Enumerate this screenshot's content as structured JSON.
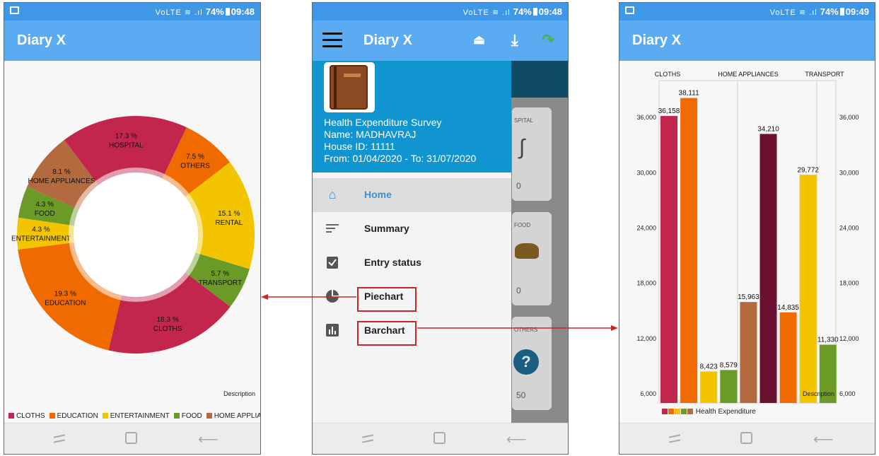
{
  "screen1": {
    "status": {
      "signal": "VoLTE ≋ .ıl",
      "battery": "74%",
      "time": "09:48"
    },
    "app_title": "Diary X",
    "colors": {
      "appbar": "#5aabf1",
      "status": "#3f97e8"
    },
    "pie": {
      "slices": [
        {
          "name": "HOSPITAL",
          "percent": "17.3 %",
          "value": 17.3,
          "color": "#c2264d"
        },
        {
          "name": "OTHERS",
          "percent": "7.5 %",
          "value": 7.5,
          "color": "#f06a00"
        },
        {
          "name": "RENTAL",
          "percent": "15.1 %",
          "value": 15.1,
          "color": "#f2c500"
        },
        {
          "name": "TRANSPORT",
          "percent": "5.7 %",
          "value": 5.7,
          "color": "#6b9a26"
        },
        {
          "name": "CLOTHS",
          "percent": "18.3 %",
          "value": 18.3,
          "color": "#c2264d"
        },
        {
          "name": "EDUCATION",
          "percent": "19.3 %",
          "value": 19.3,
          "color": "#f06a00"
        },
        {
          "name": "ENTERTAINMENT",
          "percent": "4.3 %",
          "value": 4.3,
          "color": "#f2c500"
        },
        {
          "name": "FOOD",
          "percent": "4.3 %",
          "value": 4.3,
          "color": "#6b9a26"
        },
        {
          "name": "HOME APPLIANCES",
          "percent": "8.1 %",
          "value": 8.1,
          "color": "#b26a3e"
        }
      ]
    },
    "description": "Description",
    "legend": [
      {
        "label": "CLOTHS",
        "color": "#c2264d"
      },
      {
        "label": "EDUCATION",
        "color": "#f06a00"
      },
      {
        "label": "ENTERTAINMENT",
        "color": "#f2c500"
      },
      {
        "label": "FOOD",
        "color": "#6b9a26"
      },
      {
        "label": "HOME APPLIAN",
        "color": "#b26a3e"
      }
    ]
  },
  "screen2": {
    "status": {
      "signal": "VoLTE ≋ .ıl",
      "battery": "74%",
      "time": "09:48"
    },
    "app_title": "Diary X",
    "drawer_header": {
      "survey": "Health Expenditure Survey",
      "name": "Name: MADHAVRAJ",
      "house": "House ID: 11111",
      "period": "From: 01/04/2020 - To: 31/07/2020"
    },
    "menu": [
      {
        "label": "Home",
        "icon": "home-icon"
      },
      {
        "label": "Summary",
        "icon": "sort-icon"
      },
      {
        "label": "Entry status",
        "icon": "clipboard-check-icon"
      },
      {
        "label": "Piechart",
        "icon": "piechart-icon"
      },
      {
        "label": "Barchart",
        "icon": "barchart-icon"
      }
    ],
    "behind": {
      "card1": {
        "title": "SPITAL",
        "value": "0"
      },
      "card2": {
        "title": "FOOD",
        "value": "0"
      },
      "card3": {
        "title": "OTHERS",
        "value": "50"
      }
    }
  },
  "screen3": {
    "status": {
      "signal": "VoLTE ≋ .ıl",
      "battery": "74%",
      "time": "09:49"
    },
    "app_title": "Diary X",
    "legend": "Health Expenditure",
    "description": "Description",
    "chart_data": {
      "type": "bar",
      "categories": [
        "CLOTHS",
        "HOME APPLIANCES",
        "TRANSPORT"
      ],
      "values": [
        36158,
        38111,
        8423,
        8579,
        15963,
        34210,
        14835,
        29772,
        11330
      ],
      "value_labels": [
        "36,158",
        "38,111",
        "8,423",
        "8,579",
        "15,963",
        "34,210",
        "14,835",
        "29,772",
        "11,330"
      ],
      "colors": [
        "#c2264d",
        "#f06a00",
        "#f2c500",
        "#6b9a26",
        "#b26a3e",
        "#6b1232",
        "#f06a00",
        "#f2c500",
        "#6b9a26"
      ],
      "y_ticks": [
        6000,
        12000,
        18000,
        24000,
        30000,
        36000
      ],
      "y_tick_labels": [
        "6,000",
        "12,000",
        "18,000",
        "24,000",
        "30,000",
        "36,000"
      ],
      "ylim": [
        5000,
        40000
      ],
      "grid": true
    }
  }
}
